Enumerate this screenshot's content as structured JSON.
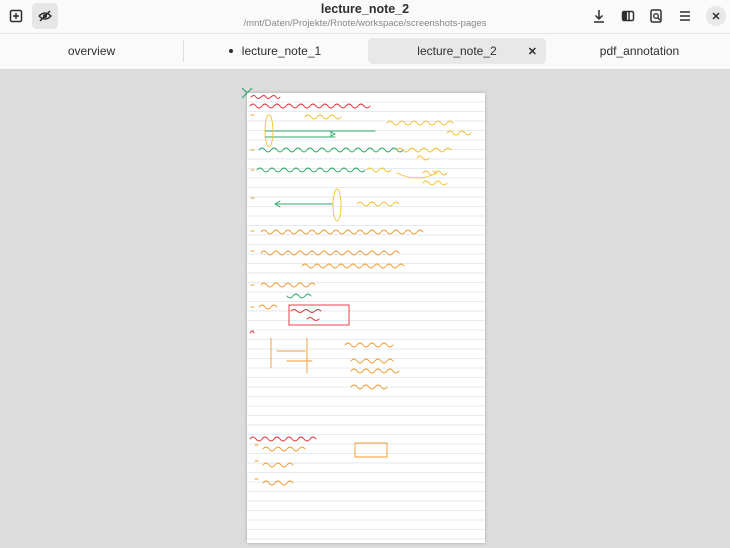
{
  "header": {
    "title": "lecture_note_2",
    "subtitle": "/mnt/Daten/Projekte/Rnote/workspace/screenshots-pages",
    "icons": [
      "new-tab-icon",
      "focus-mode-icon",
      "save-icon",
      "split-view-icon",
      "document-search-icon",
      "menu-icon",
      "close-icon"
    ]
  },
  "tabs": [
    {
      "label": "overview",
      "active": false,
      "modified": false
    },
    {
      "label": "lecture_note_1",
      "active": false,
      "modified": true
    },
    {
      "label": "lecture_note_2",
      "active": true,
      "modified": false
    },
    {
      "label": "pdf_annotation",
      "active": false,
      "modified": false
    }
  ],
  "colors": {
    "red": "#e0303a",
    "green": "#2ea86a",
    "orange": "#f39a2b",
    "yellow": "#f2c230"
  }
}
